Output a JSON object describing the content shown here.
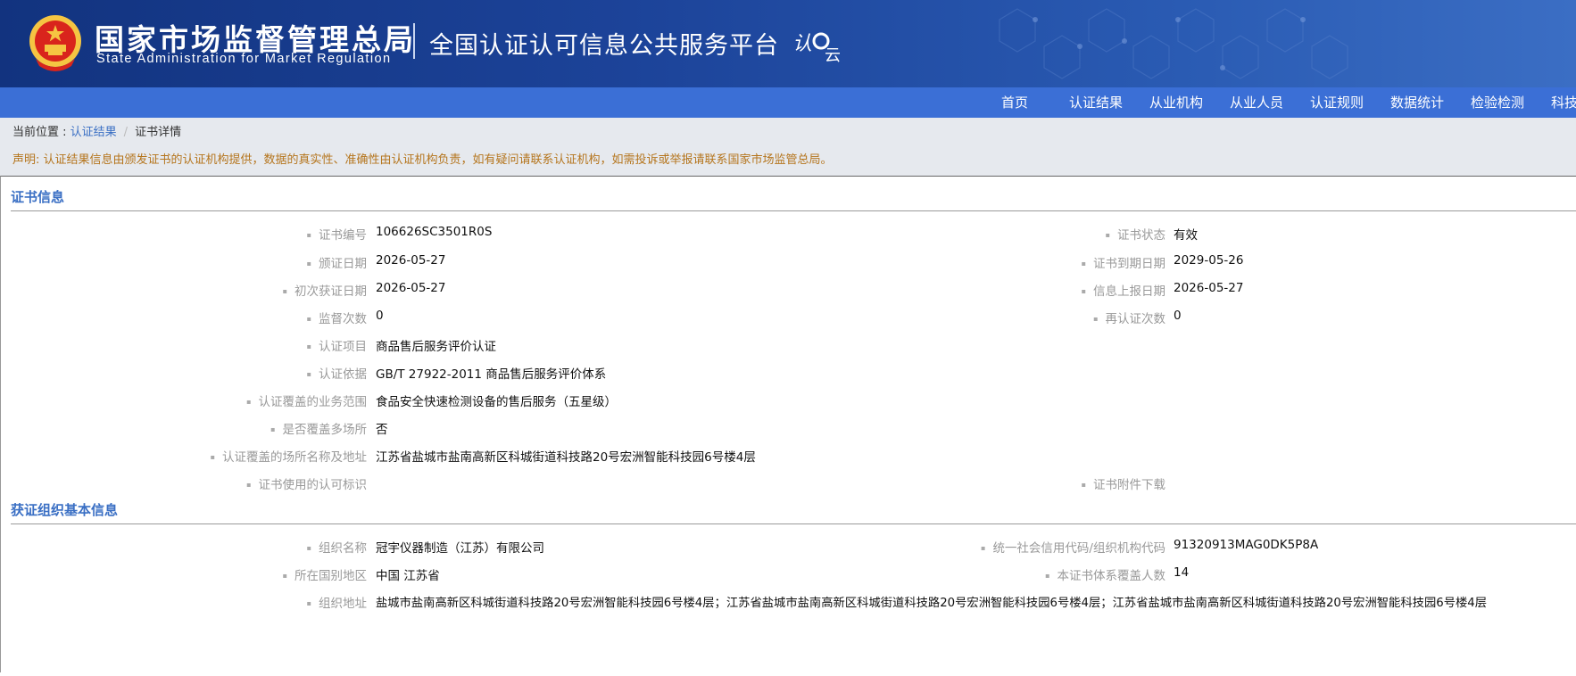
{
  "header": {
    "agency_cn": "国家市场监督管理总局",
    "agency_en": "State Administration for Market Regulation",
    "platform_title": "全国认证认可信息公共服务平台",
    "logo_text": "认云"
  },
  "nav": {
    "items": [
      "首页",
      "认证结果",
      "从业机构",
      "从业人员",
      "认证规则",
      "数据统计",
      "检验检测",
      "科技"
    ]
  },
  "breadcrumb": {
    "prefix": "当前位置 : ",
    "link": "认证结果",
    "separator": "/",
    "current": "证书详情"
  },
  "notice": "声明: 认证结果信息由颁发证书的认证机构提供，数据的真实性、准确性由认证机构负责，如有疑问请联系认证机构，如需投诉或举报请联系国家市场监管总局。",
  "certificate": {
    "title": "证书信息",
    "cert_no_label": "证书编号",
    "cert_no": "106626SC3501R0S",
    "status_label": "证书状态",
    "status": "有效",
    "issue_date_label": "颁证日期",
    "issue_date": "2026-05-27",
    "expiry_label": "证书到期日期",
    "expiry": "2029-05-26",
    "first_date_label": "初次获证日期",
    "first_date": "2026-05-27",
    "report_date_label": "信息上报日期",
    "report_date": "2026-05-27",
    "supervision_label": "监督次数",
    "supervision": "0",
    "recert_label": "再认证次数",
    "recert": "0",
    "project_label": "认证项目",
    "project": "商品售后服务评价认证",
    "basis_label": "认证依据",
    "basis": "GB/T 27922-2011 商品售后服务评价体系",
    "scope_label": "认证覆盖的业务范围",
    "scope": "食品安全快速检测设备的售后服务（五星级）",
    "multi_site_label": "是否覆盖多场所",
    "multi_site": "否",
    "site_addr_label": "认证覆盖的场所名称及地址",
    "site_addr": "江苏省盐城市盐南高新区科城街道科技路20号宏洲智能科技园6号楼4层",
    "accred_mark_label": "证书使用的认可标识",
    "attachment_label": "证书附件下载"
  },
  "organization": {
    "title": "获证组织基本信息",
    "name_label": "组织名称",
    "name": "冠宇仪器制造（江苏）有限公司",
    "credit_code_label": "统一社会信用代码/组织机构代码",
    "credit_code": "91320913MAG0DK5P8A",
    "region_label": "所在国别地区",
    "region": "中国 江苏省",
    "people_label": "本证书体系覆盖人数",
    "people": "14",
    "address_label": "组织地址",
    "address": "盐城市盐南高新区科城街道科技路20号宏洲智能科技园6号楼4层；江苏省盐城市盐南高新区科城街道科技路20号宏洲智能科技园6号楼4层；江苏省盐城市盐南高新区科城街道科技路20号宏洲智能科技园6号楼4层"
  },
  "colors": {
    "header_bg": "#1c4399",
    "nav_bg": "#3b6fd6",
    "accent": "#3a6fc4",
    "notice": "#b5751d"
  }
}
